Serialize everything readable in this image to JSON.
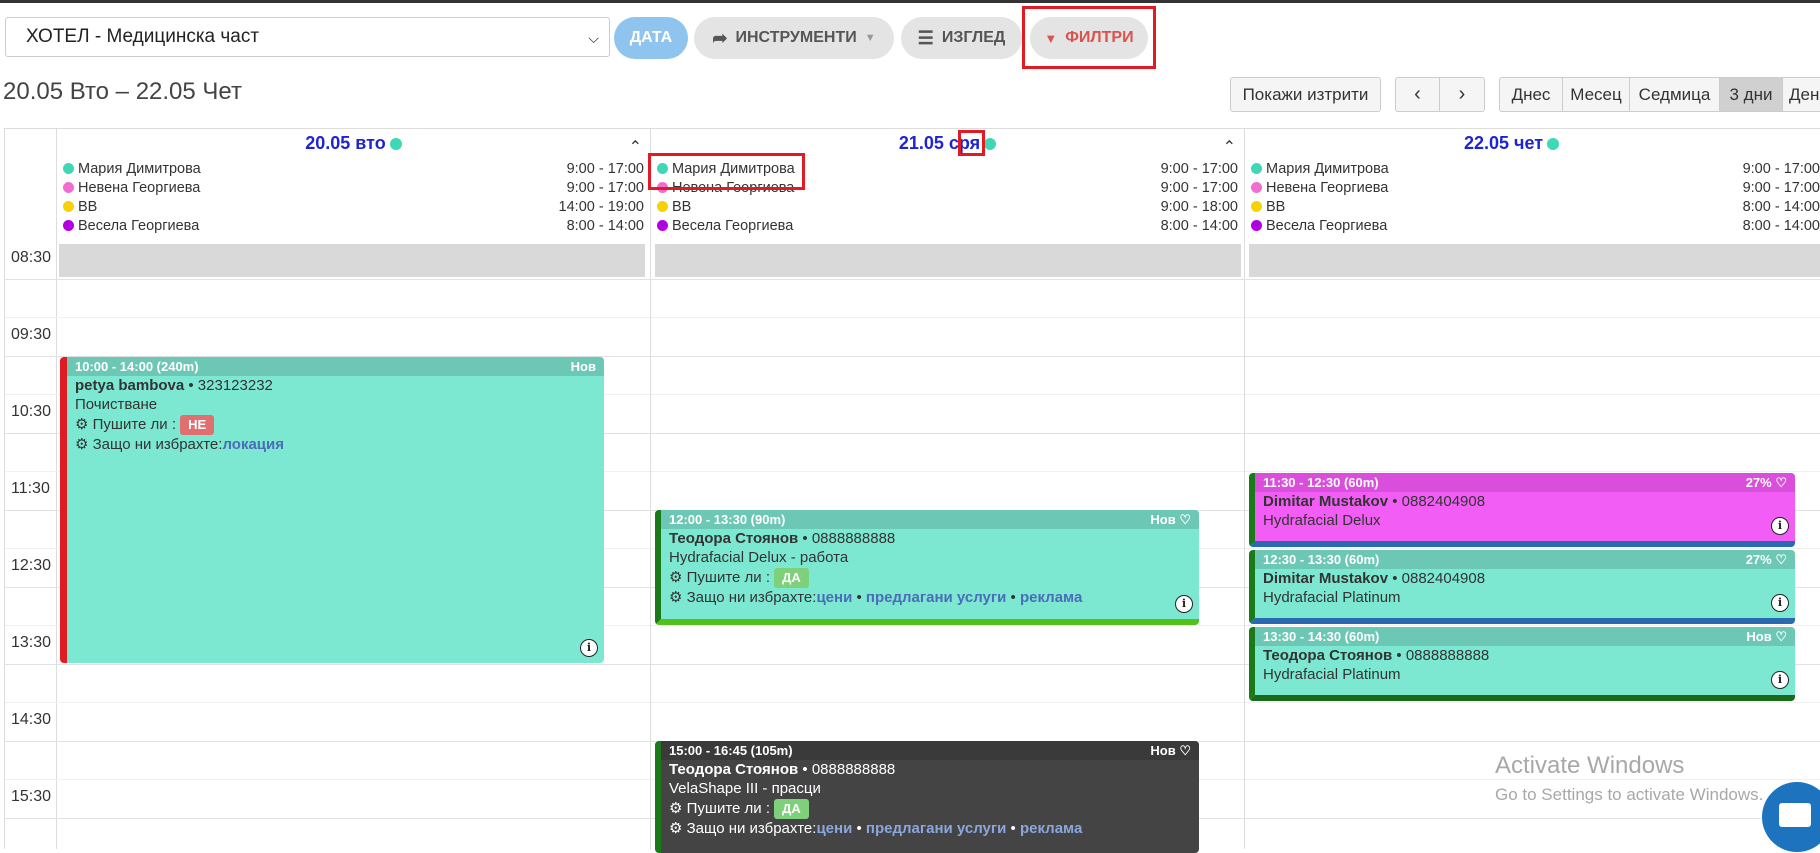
{
  "toolbar": {
    "location": "ХОТЕЛ - Медицинска част",
    "date_label": "ДАТА",
    "tools_label": "ИНСТРУМЕНТИ",
    "view_label": "ИЗГЛЕД",
    "filter_label": "ФИЛТРИ"
  },
  "range_title": "20.05 Вто – 22.05 Чет",
  "buttons": {
    "show_deleted": "Покажи изтрити",
    "views": [
      "Днес",
      "Месец",
      "Седмица",
      "3 дни",
      "Ден"
    ],
    "active_view": "3 дни"
  },
  "times": [
    "08:30",
    "09:30",
    "10:30",
    "11:30",
    "12:30",
    "13:30",
    "14:30",
    "15:30"
  ],
  "days": [
    {
      "header": "20.05 вто",
      "staff": [
        {
          "name": "Мария Димитрова",
          "hours": "9:00 - 17:00",
          "color": "#3fd8b6"
        },
        {
          "name": "Невена Георгиева",
          "hours": "9:00 - 17:00",
          "color": "#f06ecf"
        },
        {
          "name": "ВВ",
          "hours": "14:00 - 19:00",
          "color": "#f5d300"
        },
        {
          "name": "Весела Георгиева",
          "hours": "8:00 - 14:00",
          "color": "#b000e0"
        }
      ]
    },
    {
      "header": "21.05 сря",
      "staff": [
        {
          "name": "Мария Димитрова",
          "hours": "9:00 - 17:00",
          "color": "#3fd8b6"
        },
        {
          "name": "Невена Георгиева",
          "hours": "9:00 - 17:00",
          "color": "#f06ecf"
        },
        {
          "name": "ВВ",
          "hours": "9:00 - 18:00",
          "color": "#f5d300"
        },
        {
          "name": "Весела Георгиева",
          "hours": "8:00 - 14:00",
          "color": "#b000e0"
        }
      ]
    },
    {
      "header": "22.05 чет",
      "staff": [
        {
          "name": "Мария Димитрова",
          "hours": "9:00 - 17:00",
          "color": "#3fd8b6"
        },
        {
          "name": "Невена Георгиева",
          "hours": "9:00 - 17:00",
          "color": "#f06ecf"
        },
        {
          "name": "ВВ",
          "hours": "8:00 - 14:00",
          "color": "#f5d300"
        },
        {
          "name": "Весела Георгиева",
          "hours": "8:00 - 14:00",
          "color": "#b000e0"
        }
      ]
    }
  ],
  "events": {
    "e1": {
      "time": "10:00 - 14:00 (240m)",
      "status": "Нов",
      "client": "petya bambova",
      "phone": "• 323123232",
      "service": "Почистване",
      "q1": "Пушите ли :",
      "a1": "НЕ",
      "q2": "Защо ни избрахте:",
      "links": [
        "локация"
      ]
    },
    "e2": {
      "time": "12:00 - 13:30 (90m)",
      "status": "Нов",
      "client": "Теодора Стоянов",
      "phone": "• 0888888888",
      "service": "Hydrafacial Delux - работа",
      "q1": "Пушите ли :",
      "a1": "ДА",
      "q2": "Защо ни избрахте:",
      "links": [
        "цени",
        "предлагани услуги",
        "реклама"
      ],
      "sep": "•"
    },
    "e3": {
      "time": "15:00 - 16:45 (105m)",
      "status": "Нов",
      "client": "Теодора Стоянов",
      "phone": "• 0888888888",
      "service": "VelaShape III - прасци",
      "q1": "Пушите ли :",
      "a1": "ДА",
      "q2": "Защо ни избрахте:",
      "links": [
        "цени",
        "предлагани услуги",
        "реклама"
      ],
      "sep": "•"
    },
    "e4": {
      "time": "11:30 - 12:30 (60m)",
      "status": "27%",
      "client": "Dimitar Mustakov",
      "phone": "• 0882404908",
      "service": "Hydrafacial Delux"
    },
    "e5": {
      "time": "12:30 - 13:30 (60m)",
      "status": "27%",
      "client": "Dimitar Mustakov",
      "phone": "• 0882404908",
      "service": "Hydrafacial Platinum"
    },
    "e6": {
      "time": "13:30 - 14:30 (60m)",
      "status": "Нов",
      "client": "Теодора Стоянов",
      "phone": "• 0888888888",
      "service": "Hydrafacial Platinum"
    }
  },
  "watermark": {
    "line1": "Activate Windows",
    "line2": "Go to Settings to activate Windows."
  },
  "colors": {
    "turquoise": "#7de8d2",
    "magenta": "#f25ef5",
    "dark": "#444444",
    "red": "#e01b24",
    "green": "#1a7a1a"
  }
}
